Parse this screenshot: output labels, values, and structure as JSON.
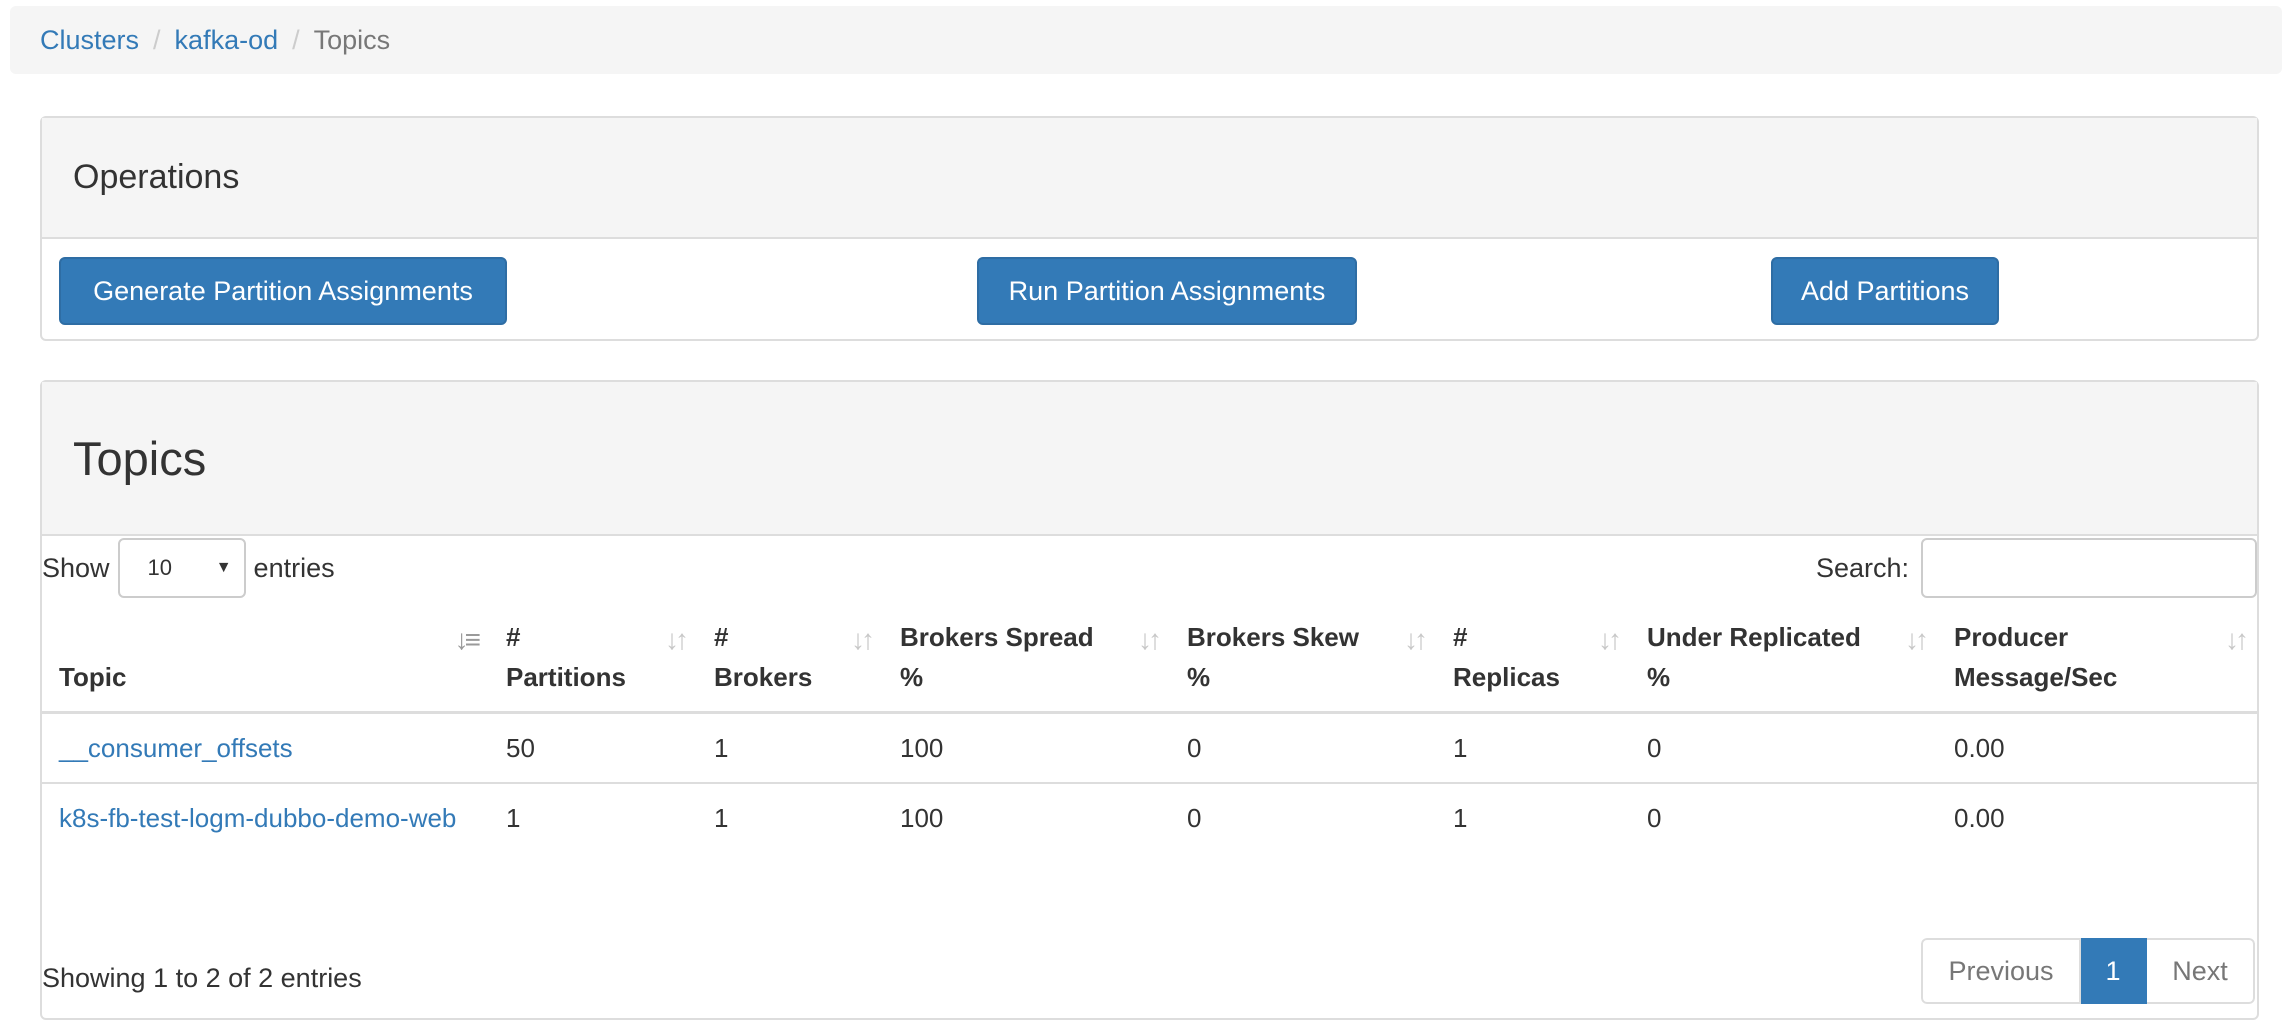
{
  "breadcrumb": {
    "items": [
      "Clusters",
      "kafka-od",
      "Topics"
    ],
    "separator": "/"
  },
  "operations": {
    "title": "Operations",
    "buttons": {
      "generate": "Generate Partition Assignments",
      "run": "Run Partition Assignments",
      "add": "Add Partitions"
    }
  },
  "topics": {
    "title": "Topics",
    "show_label": "Show",
    "entries_label": "entries",
    "page_length": "10",
    "search_label": "Search:",
    "search_value": "",
    "columns": [
      {
        "line1": "",
        "line2": "Topic",
        "sort": "sorted-asc"
      },
      {
        "line1": "#",
        "line2": "Partitions",
        "sort": "sortable"
      },
      {
        "line1": "#",
        "line2": "Brokers",
        "sort": "sortable"
      },
      {
        "line1": "Brokers Spread",
        "line2": "%",
        "sort": "sortable"
      },
      {
        "line1": "Brokers Skew",
        "line2": "%",
        "sort": "sortable"
      },
      {
        "line1": "#",
        "line2": "Replicas",
        "sort": "sortable"
      },
      {
        "line1": "Under Replicated",
        "line2": "%",
        "sort": "sortable"
      },
      {
        "line1": "Producer",
        "line2": "Message/Sec",
        "sort": "sortable"
      }
    ],
    "rows": [
      {
        "topic": "__consumer_offsets",
        "partitions": "50",
        "brokers": "1",
        "spread": "100",
        "skew": "0",
        "replicas": "1",
        "under_replicated": "0",
        "msg_sec": "0.00"
      },
      {
        "topic": "k8s-fb-test-logm-dubbo-demo-web",
        "partitions": "1",
        "brokers": "1",
        "spread": "100",
        "skew": "0",
        "replicas": "1",
        "under_replicated": "0",
        "msg_sec": "0.00"
      }
    ],
    "info": "Showing 1 to 2 of 2 entries",
    "pagination": {
      "previous": "Previous",
      "current": "1",
      "next": "Next"
    }
  },
  "colors": {
    "primary": "#337ab7",
    "panel_heading_bg": "#f5f5f5",
    "border": "#dddddd"
  }
}
